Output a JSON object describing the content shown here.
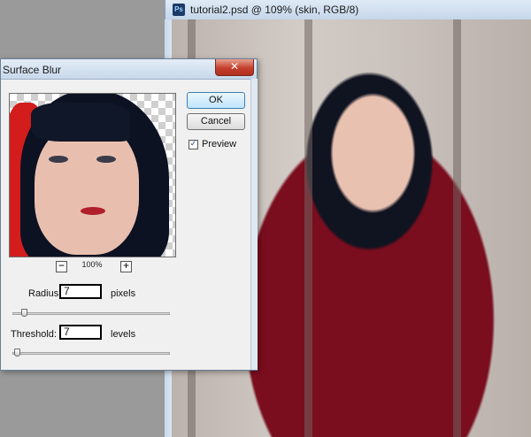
{
  "document": {
    "app_icon": "Ps",
    "title": "tutorial2.psd @ 109% (skin, RGB/8)"
  },
  "dialog": {
    "title": "Surface Blur",
    "close_glyph": "✕",
    "ok_label": "OK",
    "cancel_label": "Cancel",
    "preview_checked": true,
    "preview_check_glyph": "✓",
    "preview_label": "Preview",
    "zoom": {
      "out_glyph": "−",
      "in_glyph": "+",
      "level": "100%"
    },
    "radius": {
      "label": "Radius:",
      "value": "7",
      "unit": "pixels"
    },
    "threshold": {
      "label": "Threshold:",
      "value": "7",
      "unit": "levels"
    }
  },
  "colors": {
    "hood_red": "#7a0d1e",
    "titlebar_blue": "#c8d8ea",
    "close_red": "#c4402d"
  }
}
